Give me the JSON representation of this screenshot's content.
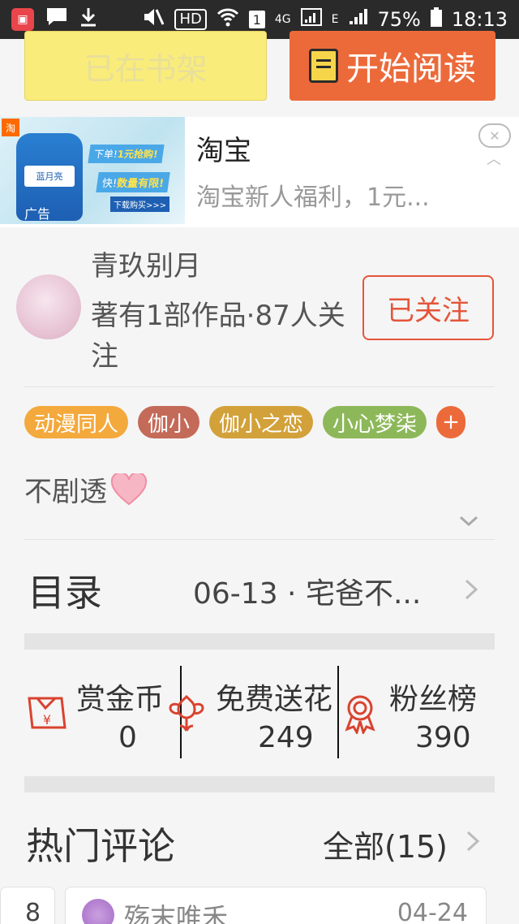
{
  "status_bar": {
    "battery": "75%",
    "time": "18:13",
    "network": "4G",
    "network_alt": "E",
    "hd": "HD",
    "sim": "1"
  },
  "actions": {
    "shelf_label": "已在书架",
    "read_label": "开始阅读"
  },
  "ad": {
    "image_corner": "淘",
    "bottle_label": "蓝月亮",
    "promo_1a": "下单!",
    "promo_1b": "1元抢购!",
    "promo_2a": "快!",
    "promo_2b": "数量有限!",
    "promo_3": "下载购买>>>",
    "tag": "广告",
    "title": "淘宝",
    "description": "淘宝新人福利，1元..."
  },
  "author": {
    "name": "青玖别月",
    "info": "著有1部作品·87人关注",
    "follow_label": "已关注"
  },
  "tags": [
    {
      "label": "动漫同人",
      "color": "#f4a93c"
    },
    {
      "label": "伽小",
      "color": "#c46a58"
    },
    {
      "label": "伽小之恋",
      "color": "#d3a13a"
    },
    {
      "label": "小心梦柒",
      "color": "#8db85a"
    }
  ],
  "tag_add": "+",
  "summary": "不剧透",
  "catalog": {
    "label": "目录",
    "latest": "06-13 · 宅爸不..."
  },
  "stats": {
    "reward_label": "赏金币",
    "reward_value": "0",
    "flower_label": "免费送花",
    "flower_value": "249",
    "fans_label": "粉丝榜",
    "fans_value": "390"
  },
  "comments": {
    "title": "热门评论",
    "all_label": "全部(15)",
    "peek_left_num": "8",
    "first_name": "殇末唯禾",
    "first_date": "04-24"
  },
  "colors": {
    "accent": "#ec6a3a",
    "follow": "#e5553a",
    "shelf": "#f9ec7a"
  }
}
